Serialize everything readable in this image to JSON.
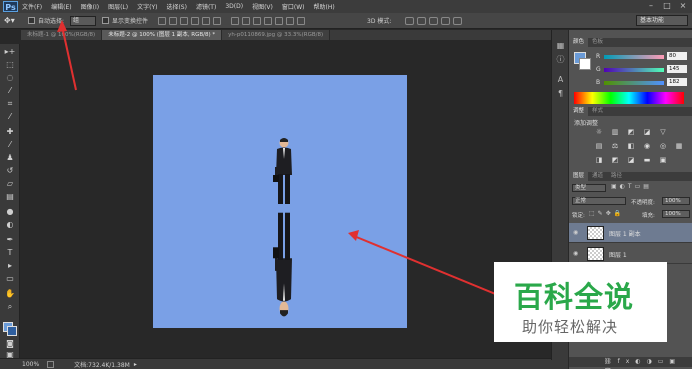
{
  "app": {
    "logo": "Ps"
  },
  "menu": [
    "文件(F)",
    "编辑(E)",
    "图像(I)",
    "图层(L)",
    "文字(Y)",
    "选择(S)",
    "滤镜(T)",
    "3D(D)",
    "视图(V)",
    "窗口(W)",
    "帮助(H)"
  ],
  "options": {
    "auto_select_label": "自动选择:",
    "auto_select_value": "组",
    "show_transform_label": "显示变换控件",
    "mode_3d_label": "3D 模式:",
    "workspace": "基本功能"
  },
  "tabs": [
    {
      "label": "未标题-1 @ 100%(RGB/8)"
    },
    {
      "label": "未标题-2 @ 100% (图层 1 副本, RGB/8) *"
    },
    {
      "label": "yh-p0110869.jpg @ 33.3%(RGB/8)"
    }
  ],
  "status": {
    "zoom": "100%",
    "doc_size": "文档:732.4K/1.38M"
  },
  "color_panel": {
    "tabs": [
      "颜色",
      "色板"
    ],
    "channels": [
      {
        "name": "R",
        "value": "80"
      },
      {
        "name": "G",
        "value": "145"
      },
      {
        "name": "B",
        "value": "182"
      }
    ],
    "fg_color": "#6a9bd8",
    "canvas_color": "#7aa0e6"
  },
  "adjust_panel": {
    "tabs": [
      "调整",
      "样式"
    ],
    "title": "添加调整"
  },
  "layers_panel": {
    "tabs": [
      "图层",
      "通道",
      "路径"
    ],
    "kind_label": "类型",
    "blend_mode": "正常",
    "opacity_label": "不透明度:",
    "opacity_value": "100%",
    "lock_label": "锁定:",
    "fill_label": "填充:",
    "fill_value": "100%",
    "layers": [
      {
        "name": "图层 1 副本"
      },
      {
        "name": "图层 1"
      }
    ]
  },
  "watermark": {
    "title": "百科全说",
    "subtitle": "助你轻松解决"
  }
}
